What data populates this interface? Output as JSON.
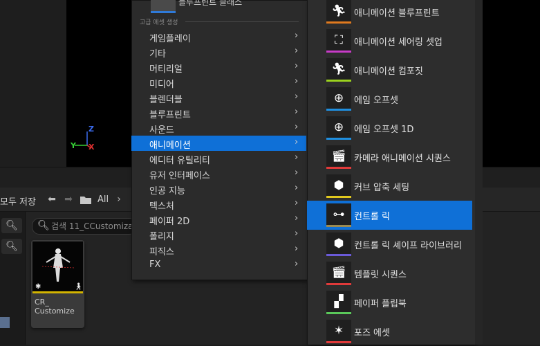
{
  "toolbar": {
    "save_all_label": "모두 저장",
    "breadcrumb_all": "All"
  },
  "search": {
    "placeholder": "검색 11_CCustomiza"
  },
  "asset": {
    "name": "CR_\nCustomize",
    "accent_color": "#d3b400"
  },
  "menu1": {
    "top_item_label": "블루프린트 클래스",
    "section_header": "고급 에셋 생성",
    "items": [
      {
        "label": "게임플레이",
        "icon": "chevron-right-icon"
      },
      {
        "label": "기타",
        "icon": "chevron-right-icon"
      },
      {
        "label": "머티리얼",
        "icon": "chevron-right-icon"
      },
      {
        "label": "미디어",
        "icon": "chevron-right-icon"
      },
      {
        "label": "블렌더블",
        "icon": "chevron-right-icon"
      },
      {
        "label": "블루프린트",
        "icon": "chevron-right-icon"
      },
      {
        "label": "사운드",
        "icon": "chevron-right-icon"
      },
      {
        "label": "애니메이션",
        "icon": "chevron-right-icon",
        "active": true
      },
      {
        "label": "에디터 유틸리티",
        "icon": "chevron-right-icon"
      },
      {
        "label": "유저 인터페이스",
        "icon": "chevron-right-icon"
      },
      {
        "label": "인공 지능",
        "icon": "chevron-right-icon"
      },
      {
        "label": "텍스처",
        "icon": "chevron-right-icon"
      },
      {
        "label": "페이퍼 2D",
        "icon": "chevron-right-icon"
      },
      {
        "label": "폴리지",
        "icon": "chevron-right-icon"
      },
      {
        "label": "피직스",
        "icon": "chevron-right-icon"
      },
      {
        "label": "FX",
        "icon": "chevron-right-icon"
      }
    ]
  },
  "menu2": {
    "items": [
      {
        "label": "애니메이션 블루프린트",
        "icon": "running-person-icon",
        "color": "#e07a1f"
      },
      {
        "label": "애니메이션 세어링 셋업",
        "icon": "hierarchy-icon",
        "color": "#c83cc8"
      },
      {
        "label": "애니메이션 컴포짓",
        "icon": "running-person-cube-icon",
        "color": "#9bd21e"
      },
      {
        "label": "에임 오프셋",
        "icon": "crosshair-icon",
        "color": "#1f8fe0"
      },
      {
        "label": "에임 오프셋 1D",
        "icon": "crosshair-icon",
        "color": "#1f8fe0"
      },
      {
        "label": "카메라 애니메이션 시퀀스",
        "icon": "clapperboard-icon",
        "color": "#e03a3a"
      },
      {
        "label": "커브 압축 세팅",
        "icon": "cube-icon",
        "color": "#e0c81e"
      },
      {
        "label": "컨트롤 릭",
        "icon": "control-rig-icon",
        "color": "#9b8a50",
        "active": true
      },
      {
        "label": "컨트롤 릭 셰이프 라이브러리",
        "icon": "cube-icon",
        "color": "#6a5ad8"
      },
      {
        "label": "템플릿 시퀀스",
        "icon": "clapperboard-icon",
        "color": "#e03a3a"
      },
      {
        "label": "페이퍼 플립북",
        "icon": "flipbook-icon",
        "color": "#5ac85a"
      },
      {
        "label": "포즈 에셋",
        "icon": "pose-figure-icon",
        "color": "#e03a3a"
      }
    ]
  },
  "gizmo": {
    "x": "X",
    "y": "Y",
    "z": "Z"
  }
}
